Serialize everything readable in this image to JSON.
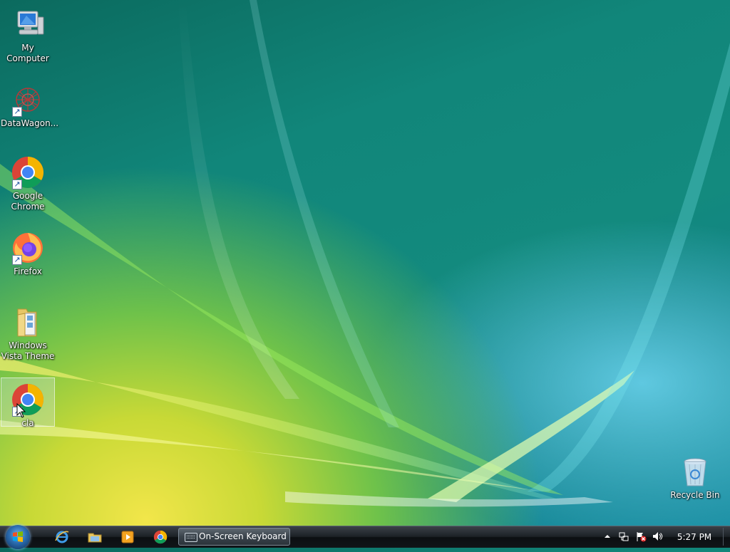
{
  "desktop": {
    "icons": [
      {
        "label": "My Computer",
        "icon": "computer-icon"
      },
      {
        "label": "DataWagon...",
        "icon": "datawagon-icon"
      },
      {
        "label": "Google Chrome",
        "icon": "chrome-icon"
      },
      {
        "label": "Firefox",
        "icon": "firefox-icon"
      },
      {
        "label": "Windows Vista Theme",
        "icon": "folder-icon"
      },
      {
        "label": "cla",
        "icon": "chrome-icon"
      },
      {
        "label": "Recycle Bin",
        "icon": "recycle-bin-icon"
      }
    ],
    "selected_icon": "cla"
  },
  "taskbar": {
    "start_button": "start-orb-icon",
    "quick_launch": [
      "internet-explorer-icon",
      "windows-explorer-icon",
      "media-player-icon",
      "chrome-icon"
    ],
    "task_buttons": [
      {
        "label": "On-Screen Keyboard",
        "icon": "keyboard-icon"
      }
    ],
    "tray_icons": [
      "show-hidden-icons-arrow-icon",
      "network-icon",
      "action-center-flag-icon",
      "volume-icon"
    ],
    "clock": "5:27 PM"
  },
  "colors": {
    "taskbar": "#1c2126",
    "wallpaper_teal": "#138a7e",
    "wallpaper_yellow": "#f2e64a"
  }
}
